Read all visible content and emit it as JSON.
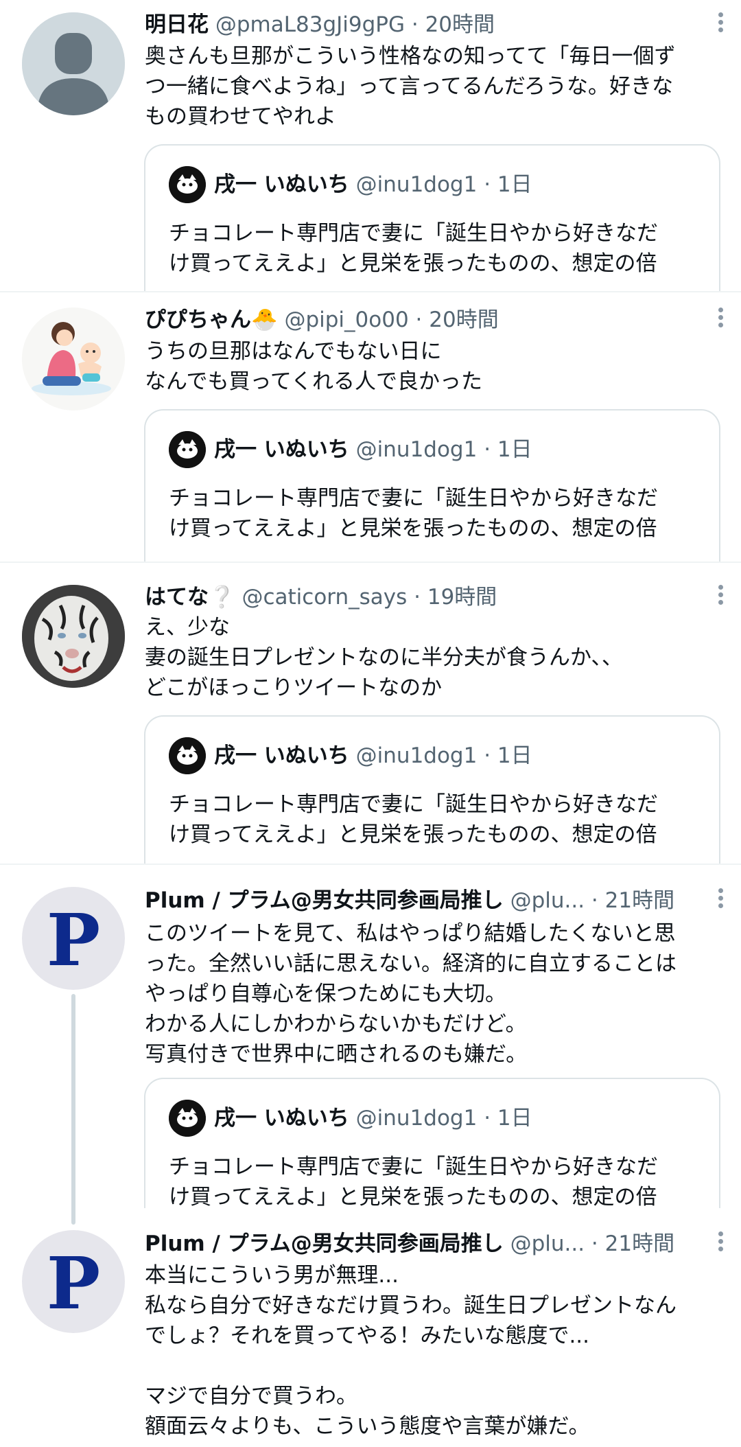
{
  "tweets": [
    {
      "name": "明日花",
      "handle": "@pmaL83gJi9gPG",
      "time": "· 20時間",
      "text": "奥さんも旦那がこういう性格なの知ってて「毎日一個ず\nつ一緒に食べようね」って言ってるんだろうな。好きな\nもの買わせてやれよ",
      "avatar_icon": "default-user-icon"
    },
    {
      "name": "ぴぴちゃん",
      "emoji": "🐣",
      "handle": "@pipi_0o00",
      "time": "· 20時間",
      "text": "うちの旦那はなんでもない日に\nなんでも買ってくれる人で良かった",
      "avatar_icon": "mother-baby-illustration"
    },
    {
      "name": "はてな",
      "emoji": "❔",
      "handle": "@caticorn_says",
      "time": "· 19時間",
      "text": "え、少な\n妻の誕生日プレゼントなのに半分夫が食うんか、、\nどこがほっこりツイートなのか",
      "avatar_icon": "white-tiger-photo"
    },
    {
      "name": "Plum / プラム@男女共同参画局推し",
      "handle": "@plu...",
      "time": "· 21時間",
      "text": "このツイートを見て、私はやっぱり結婚したくないと思\nった。全然いい話に思えない。経済的に自立することは\nやっぱり自尊心を保つためにも大切。\nわかる人にしかわからないかもだけど。\n写真付きで世界中に晒されるのも嫌だ。",
      "avatar_letter": "P"
    },
    {
      "name": "Plum / プラム@男女共同参画局推し",
      "handle": "@plu...",
      "time": "· 21時間",
      "text": "本当にこういう男が無理...\n私なら自分で好きなだけ買うわ。誕生日プレゼントなん\nでしょ？それを買ってやる！みたいな態度で...\n\nマジで自分で買うわ。\n額面云々よりも、こういう態度や言葉が嫌だ。",
      "avatar_letter": "P"
    }
  ],
  "quote": {
    "name": "戌一 いぬいち",
    "handle": "@inu1dog1",
    "time": "· 1日",
    "text": "チョコレート専門店で妻に「誕生日やから好きなだ\nけ買ってええよ」と見栄を張ったものの、想定の倍"
  },
  "icons": {
    "more": "more-vertical-icon"
  },
  "colors": {
    "text": "#0f1419",
    "secondary": "#536471",
    "divider": "#eff3f4",
    "quote_border": "#dce3e6",
    "thread_line": "#cfd9de"
  }
}
